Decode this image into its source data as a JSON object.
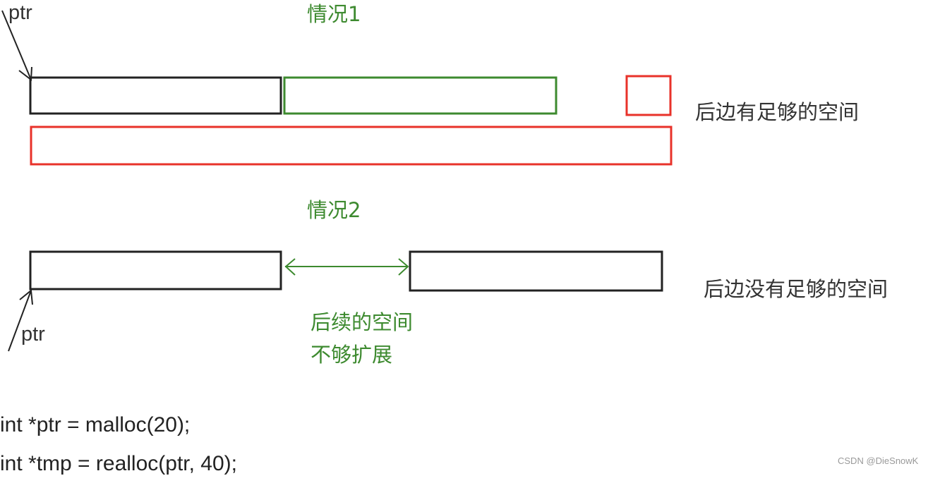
{
  "case1": {
    "title": "情况1",
    "pointer_label": "ptr",
    "note": "后边有足够的空间"
  },
  "case2": {
    "title": "情况2",
    "pointer_label": "ptr",
    "note": "后边没有足够的空间",
    "gap_note_lines": [
      "后续的空间",
      "不够扩展"
    ]
  },
  "code_lines": [
    "int *ptr = malloc(20);",
    "int *tmp = realloc(ptr, 40);"
  ],
  "watermark": "CSDN @DieSnowK",
  "colors": {
    "original_block": "#222222",
    "extension_block": "#3d8a2f",
    "new_block": "#e8322a",
    "label_green": "#3d8a2f"
  }
}
